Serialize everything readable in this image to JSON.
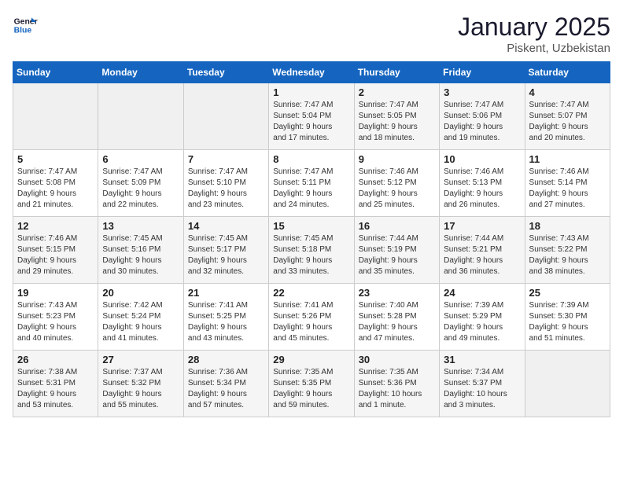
{
  "header": {
    "logo_line1": "General",
    "logo_line2": "Blue",
    "title": "January 2025",
    "location": "Piskent, Uzbekistan"
  },
  "weekdays": [
    "Sunday",
    "Monday",
    "Tuesday",
    "Wednesday",
    "Thursday",
    "Friday",
    "Saturday"
  ],
  "weeks": [
    [
      {
        "day": "",
        "info": ""
      },
      {
        "day": "",
        "info": ""
      },
      {
        "day": "",
        "info": ""
      },
      {
        "day": "1",
        "info": "Sunrise: 7:47 AM\nSunset: 5:04 PM\nDaylight: 9 hours\nand 17 minutes."
      },
      {
        "day": "2",
        "info": "Sunrise: 7:47 AM\nSunset: 5:05 PM\nDaylight: 9 hours\nand 18 minutes."
      },
      {
        "day": "3",
        "info": "Sunrise: 7:47 AM\nSunset: 5:06 PM\nDaylight: 9 hours\nand 19 minutes."
      },
      {
        "day": "4",
        "info": "Sunrise: 7:47 AM\nSunset: 5:07 PM\nDaylight: 9 hours\nand 20 minutes."
      }
    ],
    [
      {
        "day": "5",
        "info": "Sunrise: 7:47 AM\nSunset: 5:08 PM\nDaylight: 9 hours\nand 21 minutes."
      },
      {
        "day": "6",
        "info": "Sunrise: 7:47 AM\nSunset: 5:09 PM\nDaylight: 9 hours\nand 22 minutes."
      },
      {
        "day": "7",
        "info": "Sunrise: 7:47 AM\nSunset: 5:10 PM\nDaylight: 9 hours\nand 23 minutes."
      },
      {
        "day": "8",
        "info": "Sunrise: 7:47 AM\nSunset: 5:11 PM\nDaylight: 9 hours\nand 24 minutes."
      },
      {
        "day": "9",
        "info": "Sunrise: 7:46 AM\nSunset: 5:12 PM\nDaylight: 9 hours\nand 25 minutes."
      },
      {
        "day": "10",
        "info": "Sunrise: 7:46 AM\nSunset: 5:13 PM\nDaylight: 9 hours\nand 26 minutes."
      },
      {
        "day": "11",
        "info": "Sunrise: 7:46 AM\nSunset: 5:14 PM\nDaylight: 9 hours\nand 27 minutes."
      }
    ],
    [
      {
        "day": "12",
        "info": "Sunrise: 7:46 AM\nSunset: 5:15 PM\nDaylight: 9 hours\nand 29 minutes."
      },
      {
        "day": "13",
        "info": "Sunrise: 7:45 AM\nSunset: 5:16 PM\nDaylight: 9 hours\nand 30 minutes."
      },
      {
        "day": "14",
        "info": "Sunrise: 7:45 AM\nSunset: 5:17 PM\nDaylight: 9 hours\nand 32 minutes."
      },
      {
        "day": "15",
        "info": "Sunrise: 7:45 AM\nSunset: 5:18 PM\nDaylight: 9 hours\nand 33 minutes."
      },
      {
        "day": "16",
        "info": "Sunrise: 7:44 AM\nSunset: 5:19 PM\nDaylight: 9 hours\nand 35 minutes."
      },
      {
        "day": "17",
        "info": "Sunrise: 7:44 AM\nSunset: 5:21 PM\nDaylight: 9 hours\nand 36 minutes."
      },
      {
        "day": "18",
        "info": "Sunrise: 7:43 AM\nSunset: 5:22 PM\nDaylight: 9 hours\nand 38 minutes."
      }
    ],
    [
      {
        "day": "19",
        "info": "Sunrise: 7:43 AM\nSunset: 5:23 PM\nDaylight: 9 hours\nand 40 minutes."
      },
      {
        "day": "20",
        "info": "Sunrise: 7:42 AM\nSunset: 5:24 PM\nDaylight: 9 hours\nand 41 minutes."
      },
      {
        "day": "21",
        "info": "Sunrise: 7:41 AM\nSunset: 5:25 PM\nDaylight: 9 hours\nand 43 minutes."
      },
      {
        "day": "22",
        "info": "Sunrise: 7:41 AM\nSunset: 5:26 PM\nDaylight: 9 hours\nand 45 minutes."
      },
      {
        "day": "23",
        "info": "Sunrise: 7:40 AM\nSunset: 5:28 PM\nDaylight: 9 hours\nand 47 minutes."
      },
      {
        "day": "24",
        "info": "Sunrise: 7:39 AM\nSunset: 5:29 PM\nDaylight: 9 hours\nand 49 minutes."
      },
      {
        "day": "25",
        "info": "Sunrise: 7:39 AM\nSunset: 5:30 PM\nDaylight: 9 hours\nand 51 minutes."
      }
    ],
    [
      {
        "day": "26",
        "info": "Sunrise: 7:38 AM\nSunset: 5:31 PM\nDaylight: 9 hours\nand 53 minutes."
      },
      {
        "day": "27",
        "info": "Sunrise: 7:37 AM\nSunset: 5:32 PM\nDaylight: 9 hours\nand 55 minutes."
      },
      {
        "day": "28",
        "info": "Sunrise: 7:36 AM\nSunset: 5:34 PM\nDaylight: 9 hours\nand 57 minutes."
      },
      {
        "day": "29",
        "info": "Sunrise: 7:35 AM\nSunset: 5:35 PM\nDaylight: 9 hours\nand 59 minutes."
      },
      {
        "day": "30",
        "info": "Sunrise: 7:35 AM\nSunset: 5:36 PM\nDaylight: 10 hours\nand 1 minute."
      },
      {
        "day": "31",
        "info": "Sunrise: 7:34 AM\nSunset: 5:37 PM\nDaylight: 10 hours\nand 3 minutes."
      },
      {
        "day": "",
        "info": ""
      }
    ]
  ]
}
